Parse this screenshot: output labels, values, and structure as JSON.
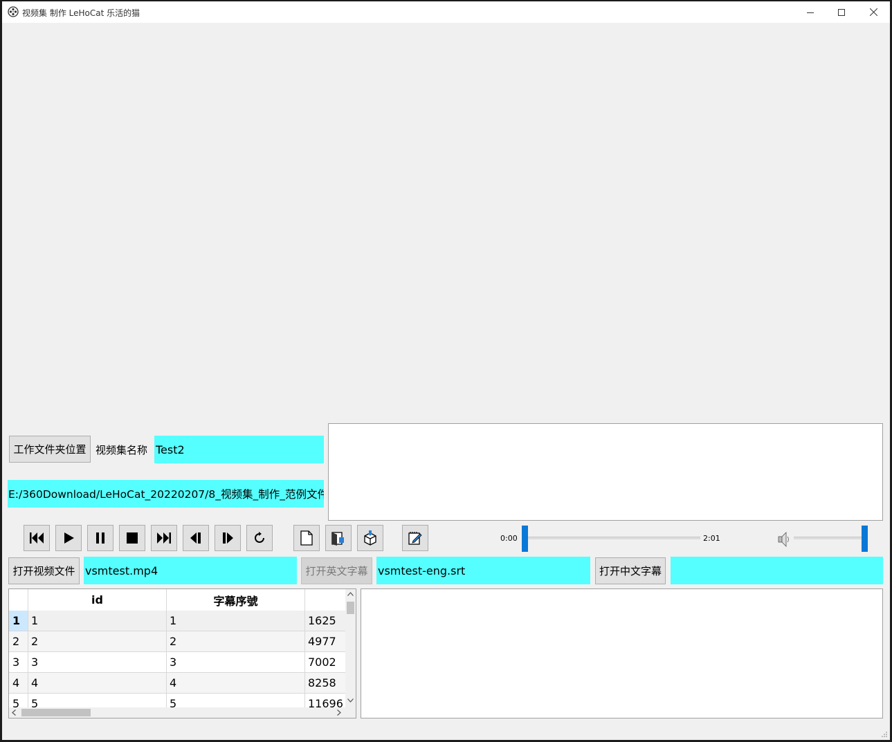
{
  "window": {
    "title": "视频集 制作  LeHoCat 乐活的猫"
  },
  "workspace": {
    "folder_button": "工作文件夹位置",
    "name_label": "视频集名称",
    "name_value": "Test2",
    "path_value": "E:/360Download/LeHoCat_20220207/8_视频集_制作_范例文件"
  },
  "player": {
    "current_time": "0:00",
    "total_time": "2:01",
    "progress": 0,
    "volume": 1.0,
    "controls": [
      "rewind-icon",
      "play-icon",
      "pause-icon",
      "stop-icon",
      "fast-forward-icon",
      "step-back-icon",
      "step-forward-icon",
      "reload-icon"
    ],
    "file_tools": [
      "new-file-icon",
      "open-file-icon",
      "package-icon",
      "edit-icon"
    ]
  },
  "files": {
    "open_video_button": "打开视频文件",
    "video_file": "vsmtest.mp4",
    "open_english_sub_button": "打开英文字幕",
    "english_sub_file": "vsmtest-eng.srt",
    "open_chinese_sub_button": "打开中文字幕",
    "chinese_sub_file": ""
  },
  "table": {
    "headers": [
      "id",
      "字幕序號"
    ],
    "rows": [
      {
        "row": "1",
        "id": "1",
        "seq": "1",
        "start": "1625"
      },
      {
        "row": "2",
        "id": "2",
        "seq": "2",
        "start": "4977"
      },
      {
        "row": "3",
        "id": "3",
        "seq": "3",
        "start": "7002"
      },
      {
        "row": "4",
        "id": "4",
        "seq": "4",
        "start": "8258"
      },
      {
        "row": "5",
        "id": "5",
        "seq": "5",
        "start": "11696"
      }
    ]
  },
  "colors": {
    "input_bg": "#55ffff",
    "slider_handle": "#0a78d7",
    "selected_row_header": "#cce8ff"
  }
}
